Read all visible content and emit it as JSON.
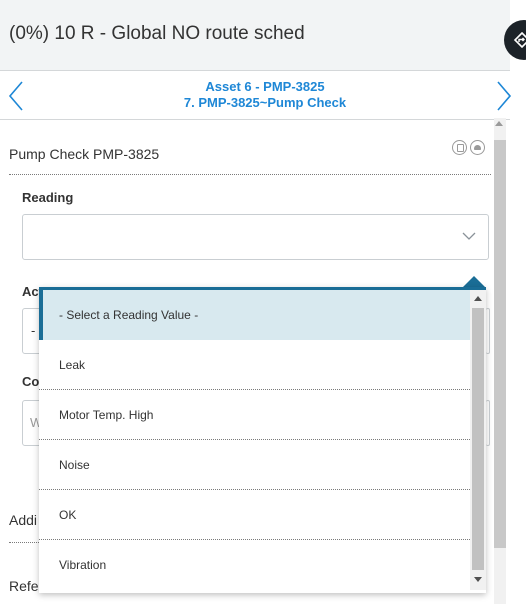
{
  "header": {
    "title": "(0%) 10 R - Global NO route sched"
  },
  "nav": {
    "asset": "Asset 6 - PMP-3825",
    "step": "7. PMP-3825~Pump Check"
  },
  "card": {
    "title": "Pump Check PMP-3825"
  },
  "form": {
    "reading_label": "Reading",
    "reading_value": "",
    "action_label_fragment": "Act",
    "action_value_fragment": "-",
    "comments_label_fragment": "Co",
    "comments_placeholder_fragment": "W",
    "additional_fragment": "Addi",
    "reference_fragment": "Refe"
  },
  "dropdown": {
    "options": [
      {
        "label": "- Select a Reading Value -",
        "selected": true
      },
      {
        "label": "Leak"
      },
      {
        "label": "Motor Temp. High"
      },
      {
        "label": "Noise"
      },
      {
        "label": "OK"
      },
      {
        "label": "Vibration"
      }
    ]
  },
  "colors": {
    "accent": "#1e87d6",
    "dropdown_border": "#1a6d96",
    "selected_bg": "#d8e9ef"
  }
}
